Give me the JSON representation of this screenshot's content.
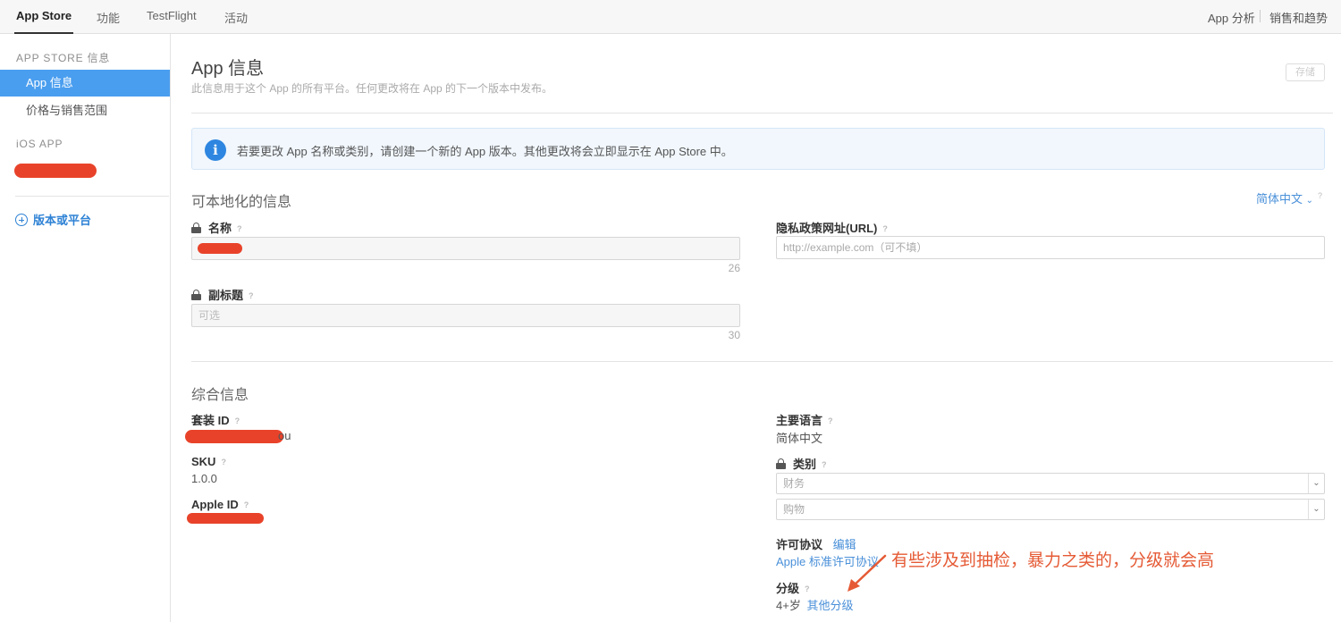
{
  "topnav": {
    "tabs": [
      "App Store",
      "功能",
      "TestFlight",
      "活动"
    ],
    "right": [
      "App 分析",
      "销售和趋势"
    ]
  },
  "sidebar": {
    "heading_store": "APP STORE 信息",
    "items": [
      "App 信息",
      "价格与销售范围"
    ],
    "heading_ios": "iOS APP",
    "version_label": "版本或平台"
  },
  "header": {
    "title": "App 信息",
    "subtitle": "此信息用于这个 App 的所有平台。任何更改将在 App 的下一个版本中发布。",
    "save": "存储"
  },
  "notice": "若要更改 App 名称或类别，请创建一个新的 App 版本。其他更改将会立即显示在 App Store 中。",
  "localizable": {
    "title": "可本地化的信息",
    "language": "简体中文",
    "name_label": "名称",
    "name_counter": "26",
    "subtitle_label": "副标题",
    "subtitle_placeholder": "可选",
    "subtitle_counter": "30",
    "privacy_label": "隐私政策网址(URL)",
    "privacy_placeholder": "http://example.com（可不填）"
  },
  "general": {
    "title": "综合信息",
    "bundle_label": "套装 ID",
    "bundle_suffix": "ou",
    "sku_label": "SKU",
    "sku_value": "1.0.0",
    "appleid_label": "Apple ID",
    "primary_lang_label": "主要语言",
    "primary_lang_value": "简体中文",
    "category_label": "类别",
    "category_primary": "财务",
    "category_secondary": "购物",
    "license_label": "许可协议",
    "license_edit": "编辑",
    "license_value": "Apple 标准许可协议",
    "rating_label": "分级",
    "rating_value": "4+岁",
    "rating_other": "其他分级"
  },
  "annotation": "有些涉及到抽检，暴力之类的，分级就会高",
  "help_mark": "?",
  "colors": {
    "accent": "#4a9eef",
    "link": "#4a90d9",
    "annotation": "#e55a35",
    "redaction": "#e8432a"
  }
}
